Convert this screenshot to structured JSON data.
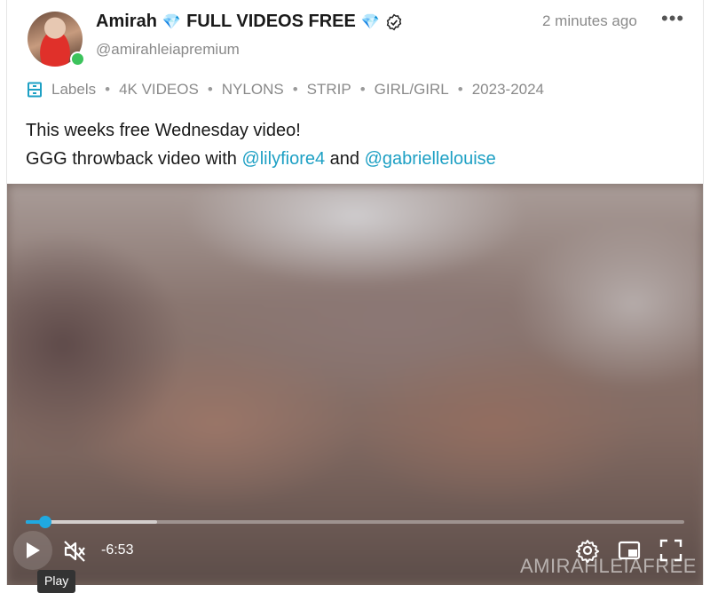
{
  "post": {
    "author_name": "Amirah",
    "author_title": "FULL VIDEOS FREE",
    "handle": "@amirahleiapremium",
    "timestamp": "2 minutes ago",
    "more_label": "•••",
    "labels_title": "Labels",
    "labels": [
      "4K VIDEOS",
      "NYLONS",
      "STRIP",
      "GIRL/GIRL",
      "2023-2024"
    ],
    "text_line1": "This weeks free Wednesday video!",
    "text_line2_prefix": "GGG throwback video with ",
    "mention_1": "@lilyfiore4",
    "text_and": " and ",
    "mention_2": "@gabriellelouise"
  },
  "player": {
    "remaining_time": "-6:53",
    "progress_fraction": 0.03,
    "buffered_fraction": 0.2,
    "tooltip": "Play",
    "watermark": "AMIRAHLEIAFREE"
  },
  "colors": {
    "accent": "#1ea0c4",
    "online": "#3cc35c",
    "diamond": "#2aa6e0"
  },
  "icons": [
    "diamond-icon",
    "verified-icon",
    "labels-icon",
    "play-icon",
    "muted-icon",
    "settings-icon",
    "pip-icon",
    "fullscreen-icon"
  ]
}
